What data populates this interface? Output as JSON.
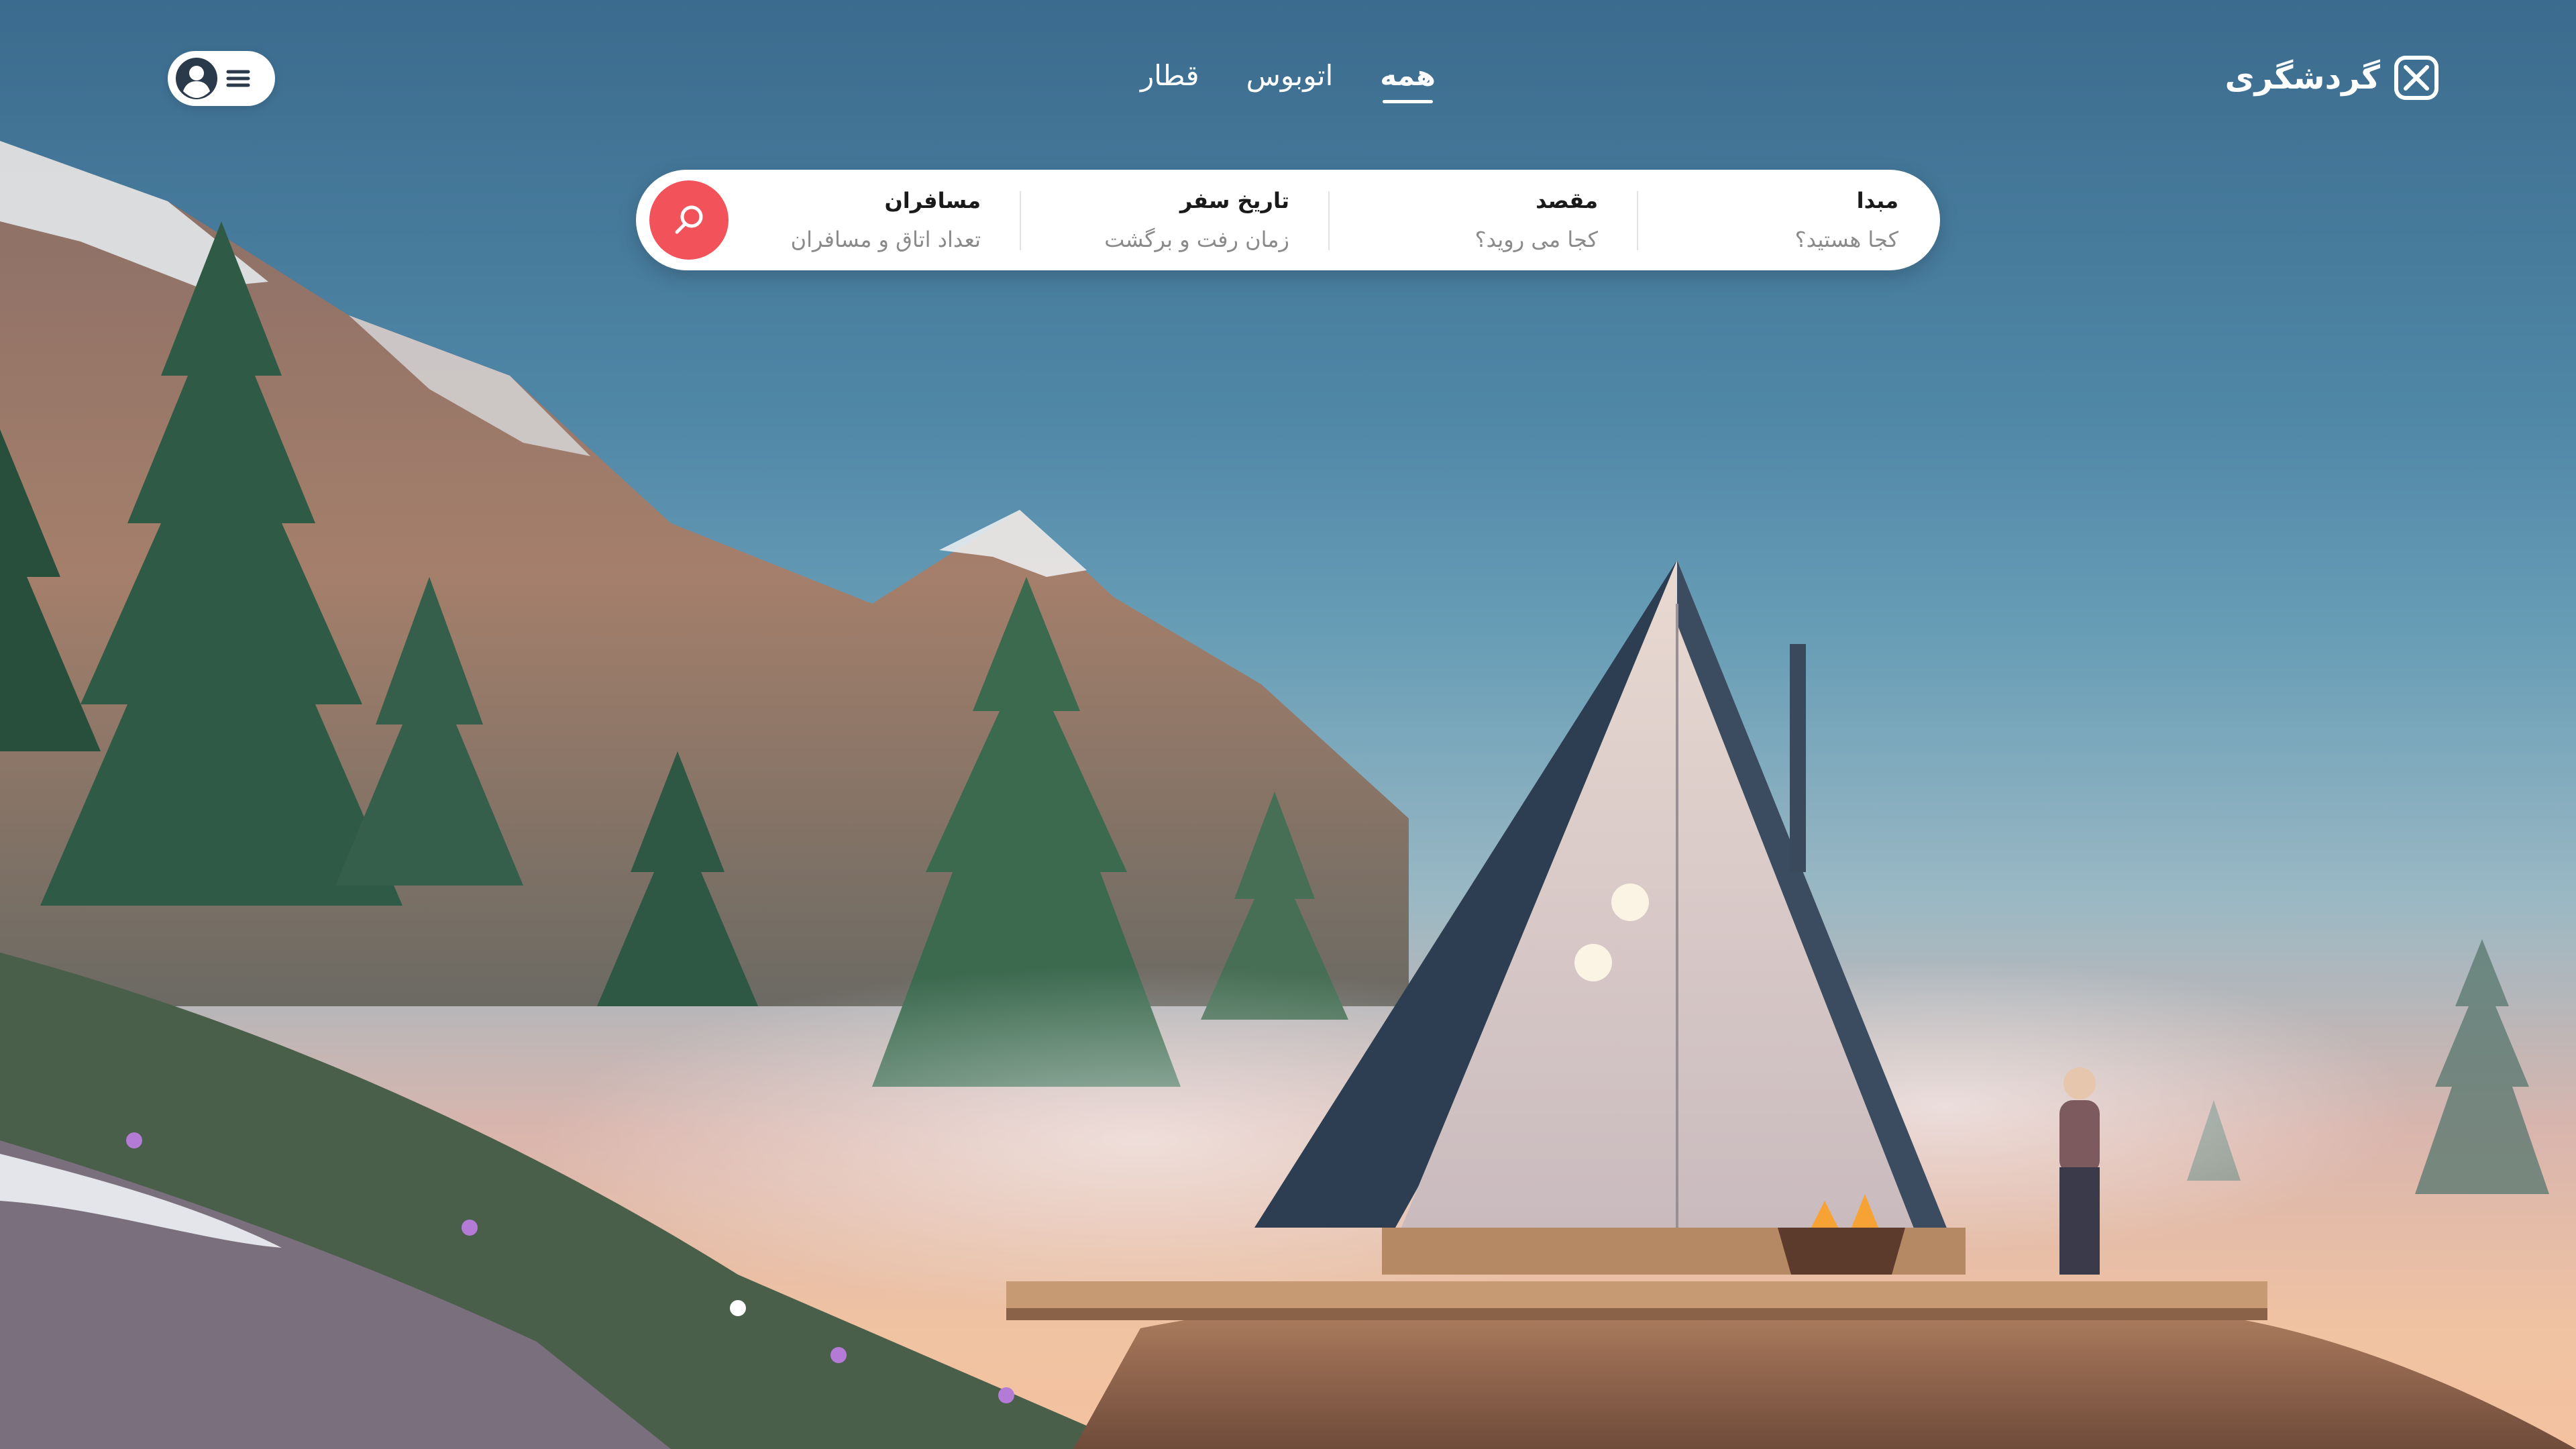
{
  "brand": {
    "name": "گردشگری",
    "logo_icon": "x-box-icon"
  },
  "nav": {
    "tabs": [
      {
        "label": "همه",
        "active": true
      },
      {
        "label": "اتوبوس",
        "active": false
      },
      {
        "label": "قطار",
        "active": false
      }
    ]
  },
  "user_menu": {
    "icons": [
      "user-avatar-icon",
      "hamburger-menu-icon"
    ]
  },
  "search": {
    "fields": [
      {
        "label": "مبدا",
        "placeholder": "کجا هستید؟"
      },
      {
        "label": "مقصد",
        "placeholder": "کجا می روید؟"
      },
      {
        "label": "تاریخ سفر",
        "placeholder": "زمان رفت و برگشت"
      },
      {
        "label": "مسافران",
        "placeholder": "تعداد اتاق و مسافران"
      }
    ],
    "button_icon": "search-icon"
  },
  "colors": {
    "accent": "#f2525a",
    "header_text": "#ffffff",
    "bar_background": "#ffffff",
    "label_text": "#1a1a1a",
    "placeholder_text": "#8a8a8a"
  }
}
